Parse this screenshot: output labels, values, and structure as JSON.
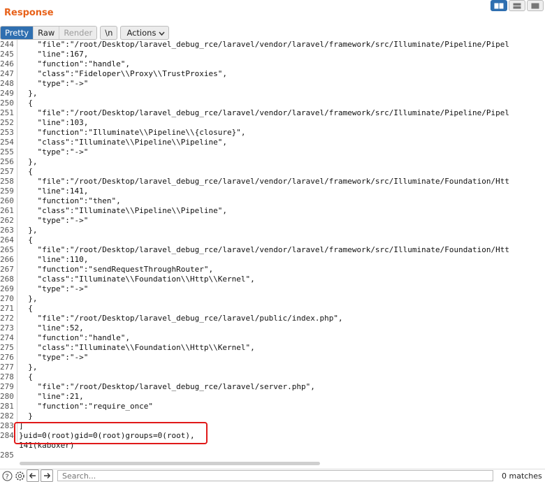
{
  "panel": {
    "title": "Response"
  },
  "layout_buttons": [
    "split-view-icon",
    "horizontal-view-icon",
    "single-view-icon"
  ],
  "tabs": {
    "pretty": "Pretty",
    "raw": "Raw",
    "render": "Render",
    "newline": "\\n",
    "actions": "Actions"
  },
  "code_lines": [
    {
      "n": "244",
      "t": "    \"file\":\"/root/Desktop/laravel_debug_rce/laravel/vendor/laravel/framework/src/Illuminate/Pipeline/Pipel"
    },
    {
      "n": "245",
      "t": "    \"line\":167,"
    },
    {
      "n": "246",
      "t": "    \"function\":\"handle\","
    },
    {
      "n": "247",
      "t": "    \"class\":\"Fideloper\\\\Proxy\\\\TrustProxies\","
    },
    {
      "n": "248",
      "t": "    \"type\":\"->\""
    },
    {
      "n": "249",
      "t": "  },"
    },
    {
      "n": "250",
      "t": "  {"
    },
    {
      "n": "251",
      "t": "    \"file\":\"/root/Desktop/laravel_debug_rce/laravel/vendor/laravel/framework/src/Illuminate/Pipeline/Pipel"
    },
    {
      "n": "252",
      "t": "    \"line\":103,"
    },
    {
      "n": "253",
      "t": "    \"function\":\"Illuminate\\\\Pipeline\\\\{closure}\","
    },
    {
      "n": "254",
      "t": "    \"class\":\"Illuminate\\\\Pipeline\\\\Pipeline\","
    },
    {
      "n": "255",
      "t": "    \"type\":\"->\""
    },
    {
      "n": "256",
      "t": "  },"
    },
    {
      "n": "257",
      "t": "  {"
    },
    {
      "n": "258",
      "t": "    \"file\":\"/root/Desktop/laravel_debug_rce/laravel/vendor/laravel/framework/src/Illuminate/Foundation/Htt"
    },
    {
      "n": "259",
      "t": "    \"line\":141,"
    },
    {
      "n": "260",
      "t": "    \"function\":\"then\","
    },
    {
      "n": "261",
      "t": "    \"class\":\"Illuminate\\\\Pipeline\\\\Pipeline\","
    },
    {
      "n": "262",
      "t": "    \"type\":\"->\""
    },
    {
      "n": "263",
      "t": "  },"
    },
    {
      "n": "264",
      "t": "  {"
    },
    {
      "n": "265",
      "t": "    \"file\":\"/root/Desktop/laravel_debug_rce/laravel/vendor/laravel/framework/src/Illuminate/Foundation/Htt"
    },
    {
      "n": "266",
      "t": "    \"line\":110,"
    },
    {
      "n": "267",
      "t": "    \"function\":\"sendRequestThroughRouter\","
    },
    {
      "n": "268",
      "t": "    \"class\":\"Illuminate\\\\Foundation\\\\Http\\\\Kernel\","
    },
    {
      "n": "269",
      "t": "    \"type\":\"->\""
    },
    {
      "n": "270",
      "t": "  },"
    },
    {
      "n": "271",
      "t": "  {"
    },
    {
      "n": "272",
      "t": "    \"file\":\"/root/Desktop/laravel_debug_rce/laravel/public/index.php\","
    },
    {
      "n": "273",
      "t": "    \"line\":52,"
    },
    {
      "n": "274",
      "t": "    \"function\":\"handle\","
    },
    {
      "n": "275",
      "t": "    \"class\":\"Illuminate\\\\Foundation\\\\Http\\\\Kernel\","
    },
    {
      "n": "276",
      "t": "    \"type\":\"->\""
    },
    {
      "n": "277",
      "t": "  },"
    },
    {
      "n": "278",
      "t": "  {"
    },
    {
      "n": "279",
      "t": "    \"file\":\"/root/Desktop/laravel_debug_rce/laravel/server.php\","
    },
    {
      "n": "280",
      "t": "    \"line\":21,"
    },
    {
      "n": "281",
      "t": "    \"function\":\"require_once\""
    },
    {
      "n": "282",
      "t": "  }"
    },
    {
      "n": "283",
      "t": "]"
    },
    {
      "n": "284",
      "t": "}uid=0(root)gid=0(root)groups=0(root),"
    },
    {
      "n": "",
      "t": "141(kaboxer)"
    },
    {
      "n": "285",
      "t": ""
    }
  ],
  "search": {
    "placeholder": "Search..."
  },
  "matches": "0 matches"
}
